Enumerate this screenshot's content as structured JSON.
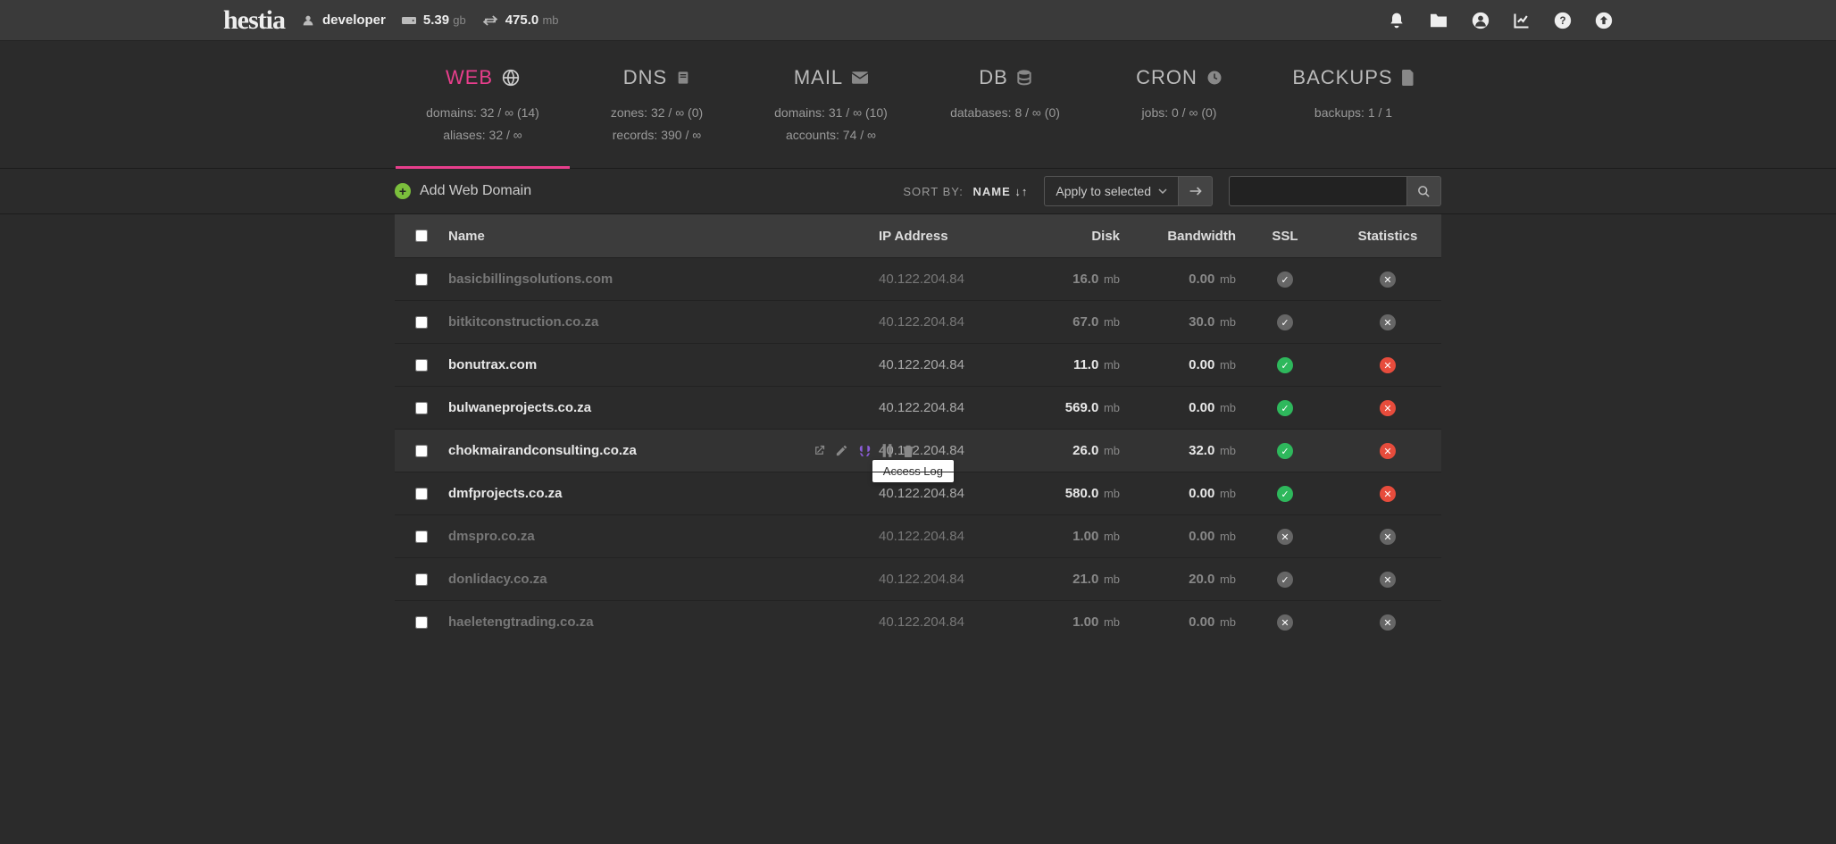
{
  "top": {
    "logo": "hestia",
    "user_label": "developer",
    "disk_val": "5.39",
    "disk_unit": "gb",
    "bw_val": "475.0",
    "bw_unit": "mb"
  },
  "nav": {
    "items": [
      {
        "title": "WEB",
        "lines": [
          "domains: 32 / ∞ (14)",
          "aliases: 32 / ∞"
        ]
      },
      {
        "title": "DNS",
        "lines": [
          "zones: 32 / ∞ (0)",
          "records: 390 / ∞"
        ]
      },
      {
        "title": "MAIL",
        "lines": [
          "domains: 31 / ∞ (10)",
          "accounts: 74 / ∞"
        ]
      },
      {
        "title": "DB",
        "lines": [
          "databases: 8 / ∞ (0)"
        ]
      },
      {
        "title": "CRON",
        "lines": [
          "jobs: 0 / ∞ (0)"
        ]
      },
      {
        "title": "BACKUPS",
        "lines": [
          "backups: 1 / 1"
        ]
      }
    ]
  },
  "toolbar": {
    "add_label": "Add Web Domain",
    "sort_label": "SORT BY:",
    "sort_value": "NAME",
    "apply_label": "Apply to selected",
    "search": ""
  },
  "headers": {
    "name": "Name",
    "ip": "IP Address",
    "disk": "Disk",
    "bw": "Bandwidth",
    "ssl": "SSL",
    "stat": "Statistics"
  },
  "tooltip": "Access Log",
  "rows": [
    {
      "name": "basicbillingsolutions.com",
      "ip": "40.122.204.84",
      "disk": "16.0",
      "bw": "0.00",
      "ssl": "muted-ok",
      "stat": "muted-no",
      "disabled": true
    },
    {
      "name": "bitkitconstruction.co.za",
      "ip": "40.122.204.84",
      "disk": "67.0",
      "bw": "30.0",
      "ssl": "muted-ok",
      "stat": "muted-no",
      "disabled": true
    },
    {
      "name": "bonutrax.com",
      "ip": "40.122.204.84",
      "disk": "11.0",
      "bw": "0.00",
      "ssl": "ok",
      "stat": "no",
      "disabled": false
    },
    {
      "name": "bulwaneprojects.co.za",
      "ip": "40.122.204.84",
      "disk": "569.0",
      "bw": "0.00",
      "ssl": "ok",
      "stat": "no",
      "disabled": false
    },
    {
      "name": "chokmairandconsulting.co.za",
      "ip": "40.122.204.84",
      "disk": "26.0",
      "bw": "32.0",
      "ssl": "ok",
      "stat": "no",
      "disabled": false,
      "hovered": true
    },
    {
      "name": "dmfprojects.co.za",
      "ip": "40.122.204.84",
      "disk": "580.0",
      "bw": "0.00",
      "ssl": "ok",
      "stat": "no",
      "disabled": false
    },
    {
      "name": "dmspro.co.za",
      "ip": "40.122.204.84",
      "disk": "1.00",
      "bw": "0.00",
      "ssl": "muted-no",
      "stat": "muted-no",
      "disabled": true
    },
    {
      "name": "donlidacy.co.za",
      "ip": "40.122.204.84",
      "disk": "21.0",
      "bw": "20.0",
      "ssl": "muted-ok",
      "stat": "muted-no",
      "disabled": true
    },
    {
      "name": "haeletengtrading.co.za",
      "ip": "40.122.204.84",
      "disk": "1.00",
      "bw": "0.00",
      "ssl": "muted-no",
      "stat": "muted-no",
      "disabled": true
    }
  ],
  "unit_mb": "mb"
}
